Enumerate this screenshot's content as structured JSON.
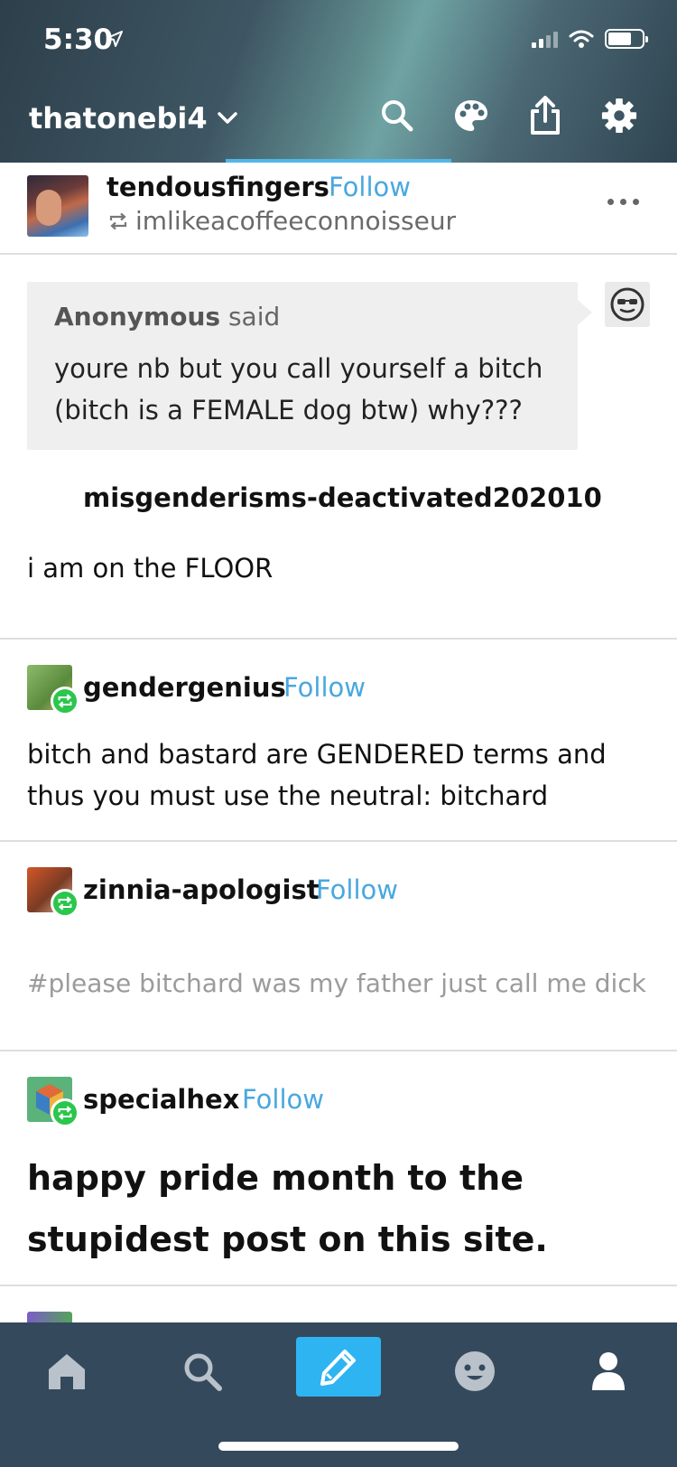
{
  "status_bar": {
    "time": "5:30"
  },
  "header": {
    "blog_name": "thatonebi4",
    "icons": [
      "search-icon",
      "palette-icon",
      "share-icon",
      "gear-icon"
    ]
  },
  "post": {
    "username": "tendousfingers",
    "follow_label": "Follow",
    "reblogged_from": "imlikeacoffeeconnoisseur",
    "ask": {
      "asker": "Anonymous",
      "said": "said",
      "question": "youre nb but you call yourself a bitch (bitch is a FEMALE dog btw) why???"
    },
    "answerer": "misgenderisms-deactivated202010",
    "answer": "i am on the FLOOR"
  },
  "trail": [
    {
      "username": "gendergenius",
      "follow_label": "Follow",
      "text": "bitch and bastard are GENDERED terms and thus you must use the neutral: bitchard"
    },
    {
      "username": "zinnia-apologist",
      "follow_label": "Follow",
      "tags": "#please bitchard was my father just call me dick"
    },
    {
      "username": "specialhex",
      "follow_label": "Follow",
      "text": "happy pride month to the stupidest post on this site."
    }
  ],
  "tabbar": {
    "items": [
      "home-icon",
      "search-icon",
      "compose-icon",
      "activity-icon",
      "account-icon"
    ]
  },
  "colors": {
    "accent": "#49a8df",
    "reblog_green": "#2bc64d",
    "tabbar": "#34495c",
    "compose": "#2fb4f2"
  }
}
